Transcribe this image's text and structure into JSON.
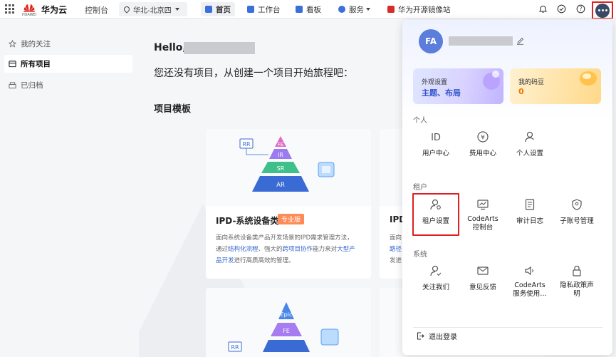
{
  "topbar": {
    "brand": "华为云",
    "brand_sub": "HUAWEI",
    "console": "控制台",
    "region": "华北-北京四",
    "nav": [
      {
        "label": "首页",
        "active": true
      },
      {
        "label": "工作台"
      },
      {
        "label": "看板"
      },
      {
        "label": "服务"
      },
      {
        "label": "华为开源镜像站"
      }
    ]
  },
  "sidebar": {
    "items": [
      {
        "label": "我的关注"
      },
      {
        "label": "所有项目",
        "active": true
      },
      {
        "label": "已归档"
      }
    ]
  },
  "main": {
    "hello": "Hello,",
    "subtitle": "您还没有项目，从创建一个项目开始旅程吧：",
    "section_title": "项目模板",
    "card1": {
      "title": "IPD-系统设备类",
      "badge": "专业版",
      "pyramid": [
        "FE",
        "IR",
        "SR",
        "AR"
      ],
      "tag": "RR",
      "desc_1": "面向系统设备类产品开发场景的IPD需求管理方法，",
      "desc_2a": "通过",
      "desc_2b": "结构化流程",
      "desc_2c": "、强大的",
      "desc_2d": "跨项目协作",
      "desc_2e": "能力来对",
      "desc_2f": "大型产",
      "desc_3a": "品开发",
      "desc_3b": "进行高质高效的管理。"
    },
    "card2": {
      "title": "IPD",
      "desc_1": "面向",
      "desc_2": "路径",
      "desc_3": "发进"
    },
    "card3": {
      "pyramid": [
        "Epic",
        "FE"
      ],
      "tag": "RR"
    }
  },
  "panel": {
    "avatar": "FA",
    "tile_appearance": {
      "label": "外观设置",
      "value": "主题、布局"
    },
    "tile_beans": {
      "label": "我的码豆",
      "value": "0"
    },
    "group_personal": {
      "title": "个人",
      "items": [
        {
          "label": "用户中心"
        },
        {
          "label": "费用中心"
        },
        {
          "label": "个人设置"
        }
      ]
    },
    "group_tenant": {
      "title": "租户",
      "items": [
        {
          "label": "租户设置"
        },
        {
          "label": "CodeArts\n控制台"
        },
        {
          "label": "审计日志"
        },
        {
          "label": "子账号管理"
        }
      ]
    },
    "group_system": {
      "title": "系统",
      "items": [
        {
          "label": "关注我们"
        },
        {
          "label": "意见反馈"
        },
        {
          "label": "CodeArts\n服务使用…"
        },
        {
          "label": "隐私政策声\n明"
        }
      ]
    },
    "logout": "退出登录"
  },
  "colors": {
    "accent": "#3366cc",
    "highlight_border": "#e02020",
    "badge": "#ff8a55"
  }
}
